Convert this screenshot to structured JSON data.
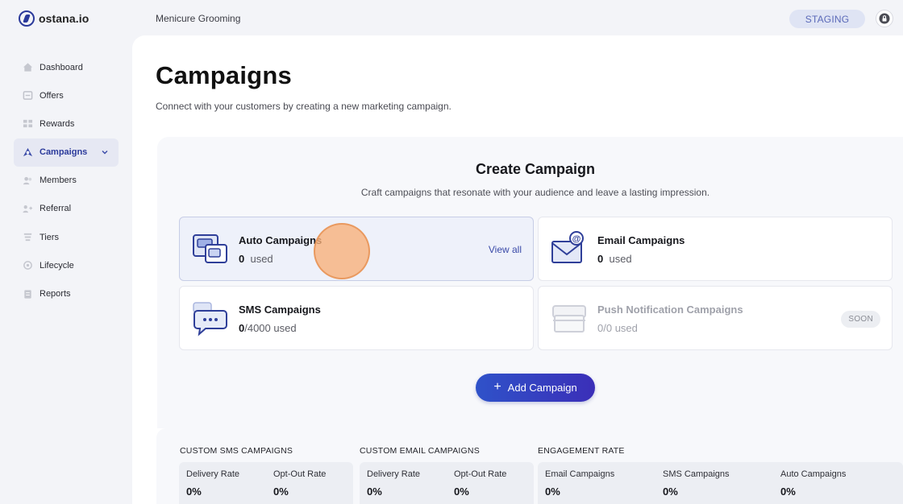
{
  "brand": {
    "name": "ostana.io"
  },
  "header": {
    "workspace": "Menicure Grooming",
    "env_badge": "STAGING"
  },
  "sidebar": {
    "items": [
      {
        "label": "Dashboard",
        "icon": "home-icon",
        "active": false
      },
      {
        "label": "Offers",
        "icon": "offer-icon",
        "active": false
      },
      {
        "label": "Rewards",
        "icon": "rewards-icon",
        "active": false
      },
      {
        "label": "Campaigns",
        "icon": "campaigns-icon",
        "active": true
      },
      {
        "label": "Members",
        "icon": "members-icon",
        "active": false
      },
      {
        "label": "Referral",
        "icon": "referral-icon",
        "active": false
      },
      {
        "label": "Tiers",
        "icon": "tiers-icon",
        "active": false
      },
      {
        "label": "Lifecycle",
        "icon": "lifecycle-icon",
        "active": false
      },
      {
        "label": "Reports",
        "icon": "reports-icon",
        "active": false
      }
    ]
  },
  "page": {
    "title": "Campaigns",
    "subtitle": "Connect with your customers by creating a new marketing campaign."
  },
  "create": {
    "title": "Create Campaign",
    "subtitle": "Craft campaigns that resonate with your audience and leave a lasting impression.",
    "cards": [
      {
        "name": "Auto Campaigns",
        "count": "0",
        "suffix": "used",
        "action": "View all"
      },
      {
        "name": "Email Campaigns",
        "count": "0",
        "suffix": "used"
      },
      {
        "name": "SMS Campaigns",
        "count": "0",
        "suffix": "/4000 used"
      },
      {
        "name": "Push Notification Campaigns",
        "count": "0/0",
        "suffix": "used",
        "badge": "SOON"
      }
    ],
    "add_button": "Add Campaign"
  },
  "stats": {
    "sms": {
      "heading": "CUSTOM SMS CAMPAIGNS",
      "cells": [
        {
          "label": "Delivery Rate",
          "value": "0%"
        },
        {
          "label": "Opt-Out Rate",
          "value": "0%"
        }
      ]
    },
    "email": {
      "heading": "CUSTOM EMAIL CAMPAIGNS",
      "cells": [
        {
          "label": "Delivery Rate",
          "value": "0%"
        },
        {
          "label": "Opt-Out Rate",
          "value": "0%"
        }
      ]
    },
    "engagement": {
      "heading": "ENGAGEMENT RATE",
      "cells": [
        {
          "label": "Email Campaigns",
          "value": "0%"
        },
        {
          "label": "SMS Campaigns",
          "value": "0%"
        },
        {
          "label": "Auto Campaigns",
          "value": "0%"
        }
      ]
    }
  },
  "colors": {
    "accent": "#2b3a9b",
    "button_start": "#2f52c9",
    "button_end": "#3b2fb8",
    "cursor": "#f8b078"
  }
}
